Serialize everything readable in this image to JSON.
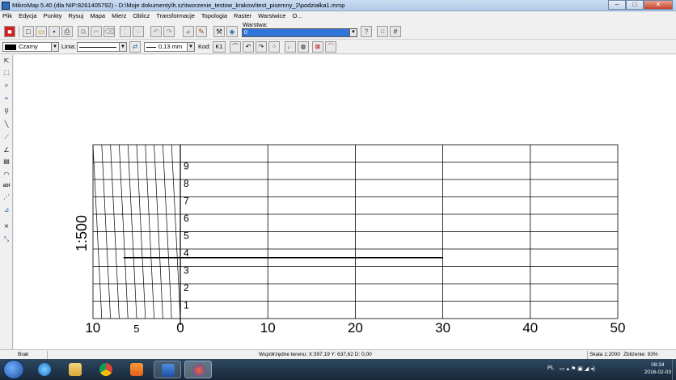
{
  "window": {
    "title": "MikroMap 5.40 (dla NIP:8261405792) - D:\\Moje dokumenty\\h.sz\\tworzenie_testow_krakow\\test_pisemny_2\\podziałka1.mmp",
    "minimize": "–",
    "maximize": "□",
    "close": "✕"
  },
  "menu": [
    "Plik",
    "Edycja",
    "Punkty",
    "Rysuj",
    "Mapa",
    "Mierz",
    "Oblicz",
    "Transformacje",
    "Topologia",
    "Raster",
    "Warstwice",
    "O..."
  ],
  "toolbar1": {
    "layer_label": "Warstwa:",
    "layer_value": "0"
  },
  "toolbar2": {
    "color_value": "Czarny",
    "line_label": "Linia:",
    "thickness_value": "0,13 mm",
    "code_label": "Kod:",
    "code_value": "K1"
  },
  "scale_bar": {
    "scale_label": "1:500",
    "x_labels": [
      "10",
      "5",
      "0",
      "10",
      "20",
      "30",
      "40",
      "50"
    ],
    "y_labels": [
      "1",
      "2",
      "3",
      "4",
      "5",
      "6",
      "7",
      "8",
      "9"
    ]
  },
  "statusbar": {
    "mode": "Brak",
    "coords": "Współrzędne terenu: X:397,19 Y: 637,62  D: 0,00",
    "scale": "Skala 1:2000",
    "zoom": "Zbliżenie: 93%"
  },
  "taskbar": {
    "lang": "PL",
    "time": "08:34",
    "date": "2016-02-03"
  }
}
